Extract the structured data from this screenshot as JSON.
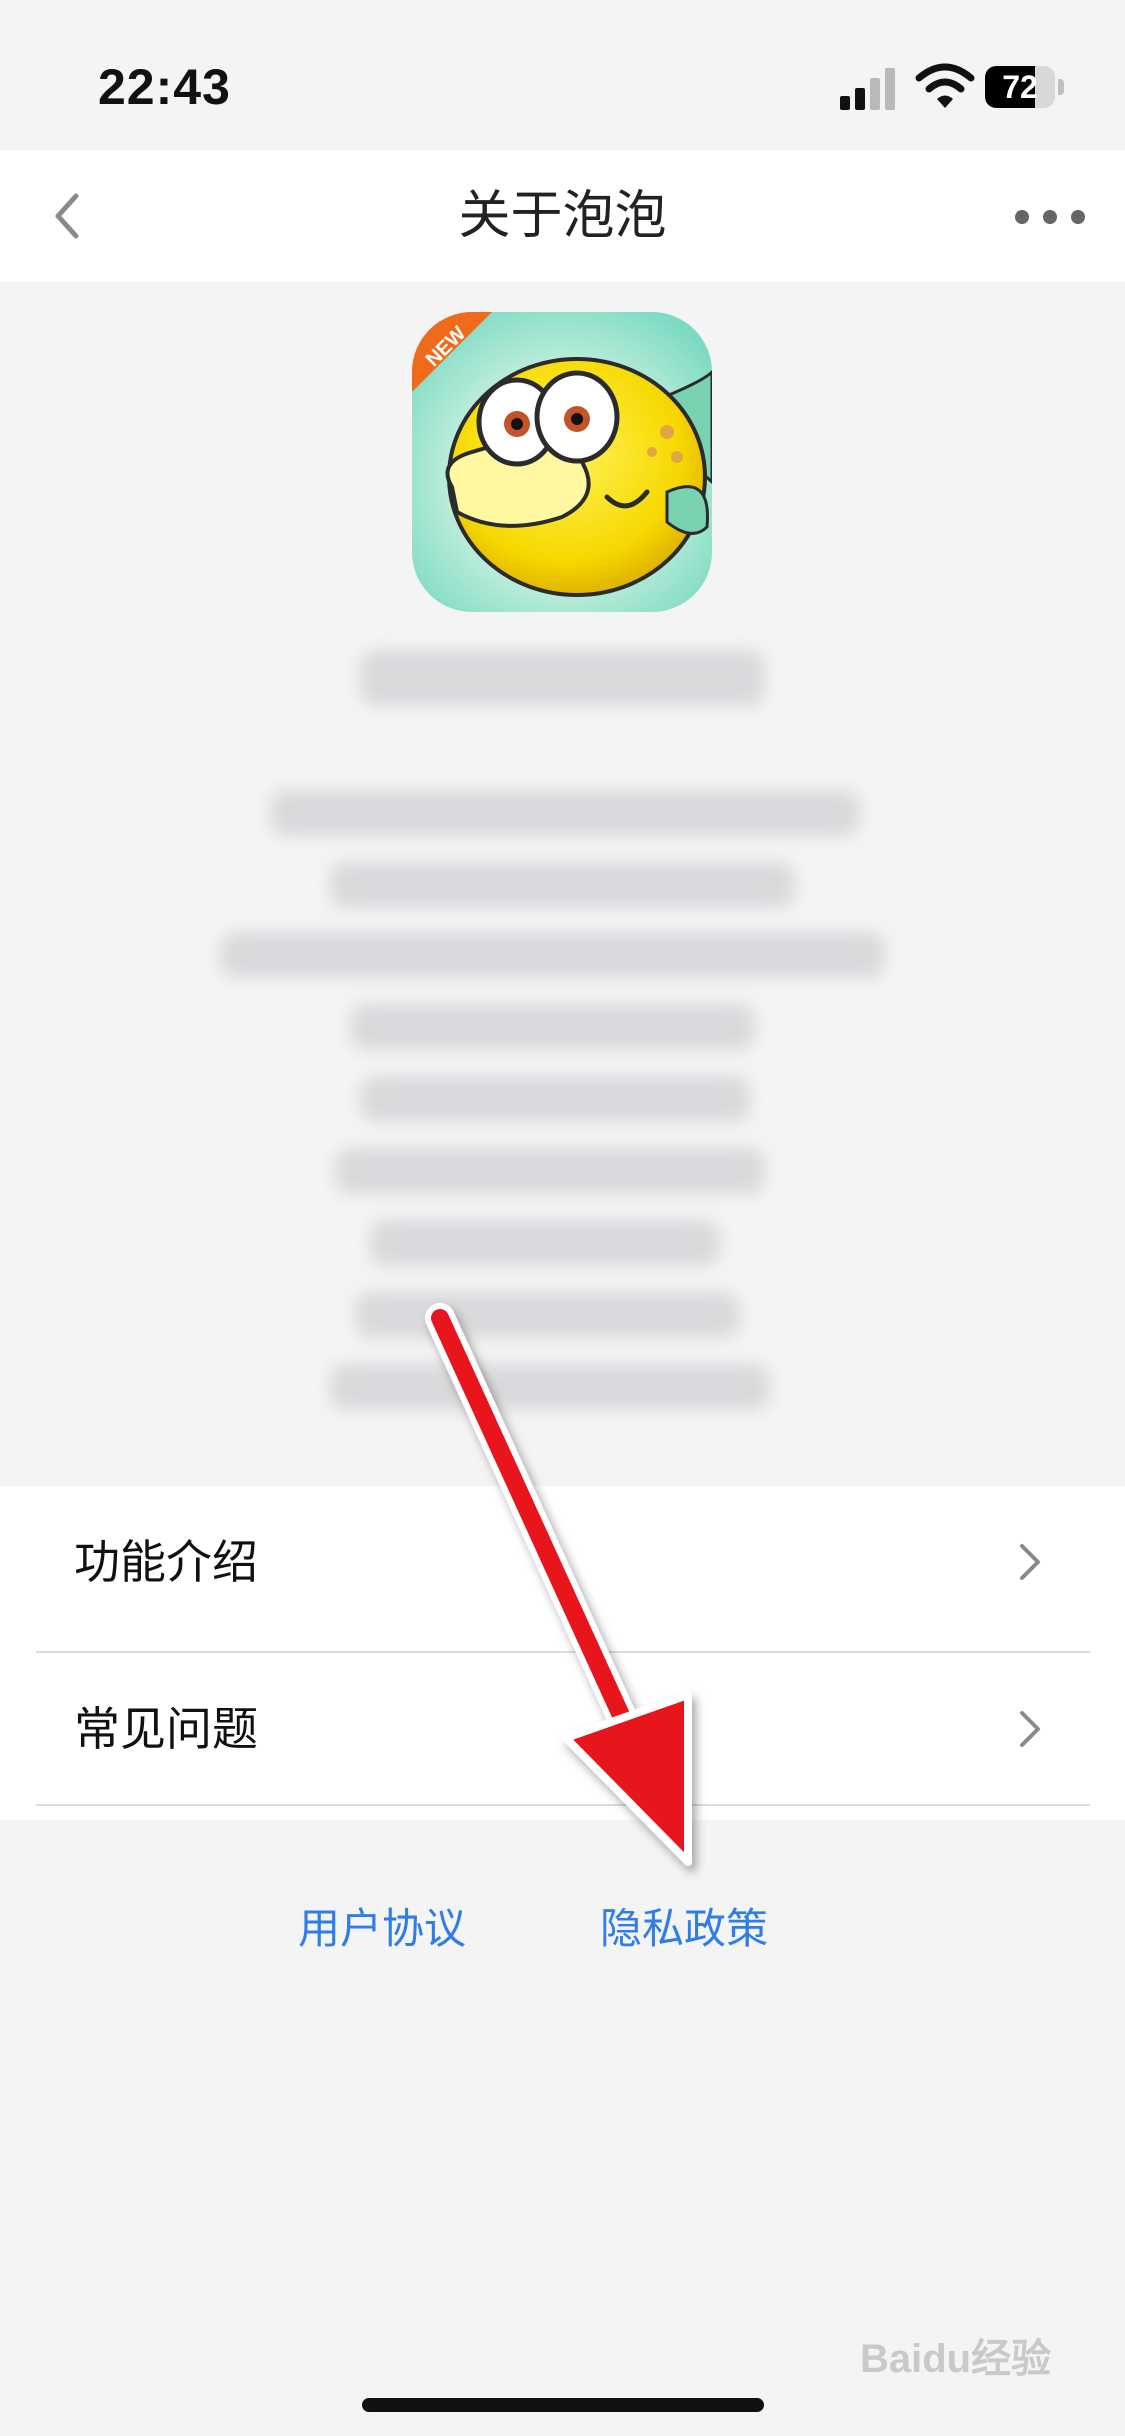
{
  "status_bar": {
    "time": "22:43",
    "battery_level": "72",
    "battery_fraction": 0.72,
    "icons": [
      "cellular-signal-icon",
      "wifi-icon",
      "battery-icon"
    ]
  },
  "nav": {
    "title": "关于泡泡",
    "back_icon": "chevron-left-icon",
    "more_icon": "more-dots-icon"
  },
  "app_icon": {
    "badge": "NEW",
    "description_icon": "yellow-fish-icon"
  },
  "menu": {
    "items": [
      {
        "label": "功能介绍",
        "icon": "chevron-right-icon"
      },
      {
        "label": "常见问题",
        "icon": "chevron-right-icon"
      }
    ]
  },
  "links": {
    "user_agreement": "用户协议",
    "privacy_policy": "隐私政策"
  },
  "watermark": {
    "text": "Baidu经验"
  },
  "colors": {
    "background": "#f4f4f5",
    "link": "#2f7ee8",
    "annotation_arrow": "#e8131b"
  }
}
